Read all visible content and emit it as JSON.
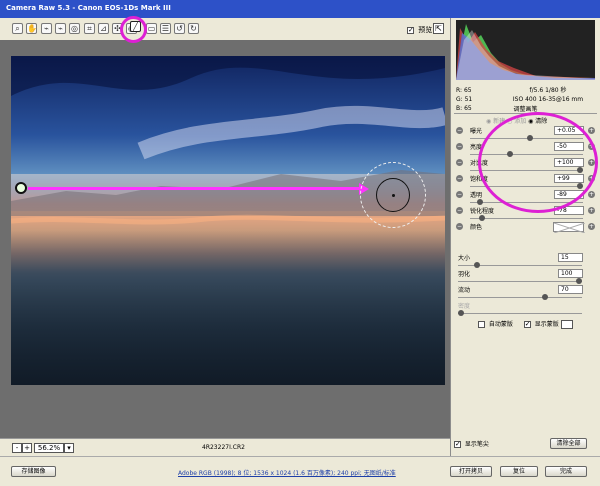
{
  "window": {
    "title": "Camera Raw 5.3 -  Canon EOS-1Ds Mark III"
  },
  "toolbar": {
    "preview_label": "预览",
    "preview_checked": "✓",
    "export_icon": "⇱"
  },
  "status": {
    "zoom_minus": "-",
    "zoom_plus": "+",
    "zoom": "56.2%",
    "zoom_arrow": "▾",
    "filename": "4R23227I.CR2"
  },
  "panel": {
    "rgb": {
      "r_label": "R:",
      "r_value": "65",
      "g_label": "G:",
      "g_value": "51",
      "b_label": "B:",
      "b_value": "65"
    },
    "camera": {
      "exposure": "f/5.6  1/80 秒",
      "iso_lens": "ISO 400   16-35@16 mm"
    },
    "section_title": "调整画笔",
    "modes": {
      "new": "◉ 新建",
      "add": "○ 添加",
      "clear": "◉ 清除"
    },
    "sliders": [
      {
        "minus": "−",
        "label": "曝光",
        "value": "+0.05",
        "plus": "+",
        "position": 0.53
      },
      {
        "minus": "−",
        "label": "亮度",
        "value": "-50",
        "plus": "+",
        "position": 0.35
      },
      {
        "minus": "−",
        "label": "对比度",
        "value": "+100",
        "plus": "+",
        "position": 1.0
      },
      {
        "minus": "−",
        "label": "饱和度",
        "value": "+99",
        "plus": "+",
        "position": 0.99
      },
      {
        "minus": "−",
        "label": "透明",
        "value": "-89",
        "plus": "+",
        "position": 0.09
      },
      {
        "minus": "−",
        "label": "锐化程度",
        "value": "-78",
        "plus": "+",
        "position": 0.11
      },
      {
        "minus": "−",
        "label": "颜色",
        "value": "",
        "plus": "+",
        "position": 0.0
      }
    ],
    "brush": {
      "size_label": "大小",
      "size_value": "15",
      "size_position": 0.15,
      "feather_label": "羽化",
      "feather_value": "100",
      "feather_position": 1.0,
      "flow_label": "流动",
      "flow_value": "70",
      "flow_position": 0.7,
      "density_label": "密度",
      "density_value": "",
      "density_position": 0.0
    },
    "options": {
      "auto_mask": "自动蒙版",
      "show_mask": "显示蒙版",
      "show_mask_checked": "✓"
    },
    "bottom": {
      "show_pins": "显示笔尖",
      "show_pins_checked": "✓",
      "clear_all": "清除全部"
    }
  },
  "footer": {
    "save_image": "存储图像",
    "color_info": "Adobe RGB (1998); 8 位; 1536 x 1024 (1.6 百万像素); 240 ppi; 无图纸/标准",
    "open_copy": "打开拷贝",
    "reset": "复位",
    "done": "完成"
  },
  "colors": {
    "highlight": "#dd20d4",
    "arrow": "#ff34ff",
    "chrome": "#ece9d8",
    "title_blue": "#2d51c8"
  },
  "icons": [
    "zoom-icon",
    "hand-icon",
    "white-balance-icon",
    "color-sampler-icon",
    "target-adjustment-icon",
    "crop-icon",
    "straighten-icon",
    "spot-removal-icon",
    "red-eye-icon",
    "adjustment-brush-icon",
    "graduated-filter-icon",
    "preferences-icon",
    "rotate-left-icon",
    "rotate-right-icon"
  ]
}
